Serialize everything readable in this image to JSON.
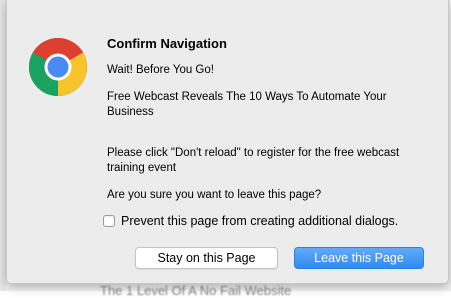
{
  "dialog": {
    "title": "Confirm Navigation",
    "line1": "Wait! Before You Go!",
    "line2": "Free Webcast Reveals The 10 Ways To Automate Your Business",
    "line3": "Please click \"Don't reload\" to register for the free webcast training event",
    "question": "Are you sure you want to leave this page?",
    "checkbox_label": "Prevent this page from creating additional dialogs.",
    "checkbox_checked": false,
    "stay_button": "Stay on this Page",
    "leave_button": "Leave this Page",
    "icon": "chrome-logo-icon"
  },
  "backdrop": {
    "partial_text": "The 1 Level Of A No Fail Website"
  },
  "colors": {
    "dialog_bg": "#ececec",
    "primary_button": "#3b8ff5"
  }
}
